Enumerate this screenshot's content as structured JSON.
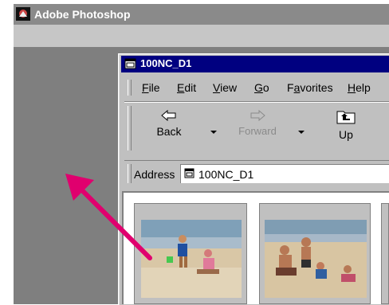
{
  "photoshop": {
    "title": "Adobe Photoshop"
  },
  "explorer": {
    "title": "100NC_D1",
    "menu": [
      {
        "pre": "",
        "u": "F",
        "post": "ile"
      },
      {
        "pre": "",
        "u": "E",
        "post": "dit"
      },
      {
        "pre": "",
        "u": "V",
        "post": "iew"
      },
      {
        "pre": "",
        "u": "G",
        "post": "o"
      },
      {
        "pre": "F",
        "u": "a",
        "post": "vorites"
      },
      {
        "pre": "",
        "u": "H",
        "post": "elp"
      }
    ],
    "toolbar": {
      "back_label": "Back",
      "forward_label": "Forward",
      "up_label": "Up"
    },
    "address": {
      "label": "Address",
      "value": "100NC_D1"
    }
  },
  "colors": {
    "explorer_title_bg": "#000080",
    "arrow": "#e0006e",
    "workspace": "#7f7f7f"
  },
  "icons": {
    "photoshop": "photoshop-app-icon",
    "folder": "folder-icon",
    "back": "back-arrow-icon",
    "forward": "forward-arrow-icon",
    "up": "up-folder-icon",
    "pointer": "pink-arrow-pointer"
  }
}
